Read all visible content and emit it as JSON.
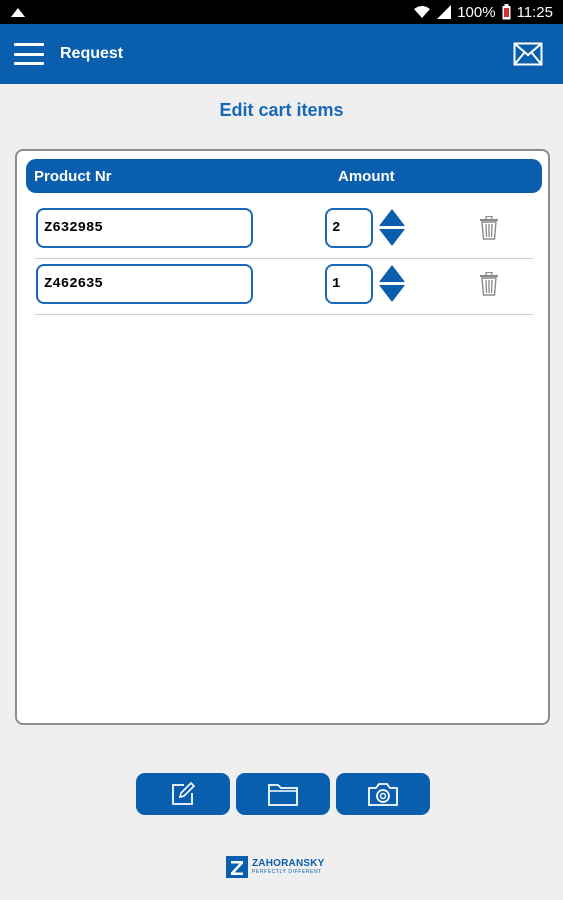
{
  "status_bar": {
    "battery": "100%",
    "time": "11:25"
  },
  "app_bar": {
    "title": "Request"
  },
  "page": {
    "title": "Edit cart items"
  },
  "table": {
    "headers": {
      "product": "Product Nr",
      "amount": "Amount"
    },
    "rows": [
      {
        "product_nr": "Z632985",
        "amount": "2"
      },
      {
        "product_nr": "Z462635",
        "amount": "1"
      }
    ]
  },
  "toolbar": {
    "icons": [
      "edit-icon",
      "folder-icon",
      "camera-icon"
    ]
  },
  "logo": {
    "name": "ZAHORANSKY",
    "tagline": "PERFECTLY DIFFERENT"
  },
  "colors": {
    "primary": "#0a5eae",
    "title_text": "#1769b8",
    "background": "#efefef"
  }
}
